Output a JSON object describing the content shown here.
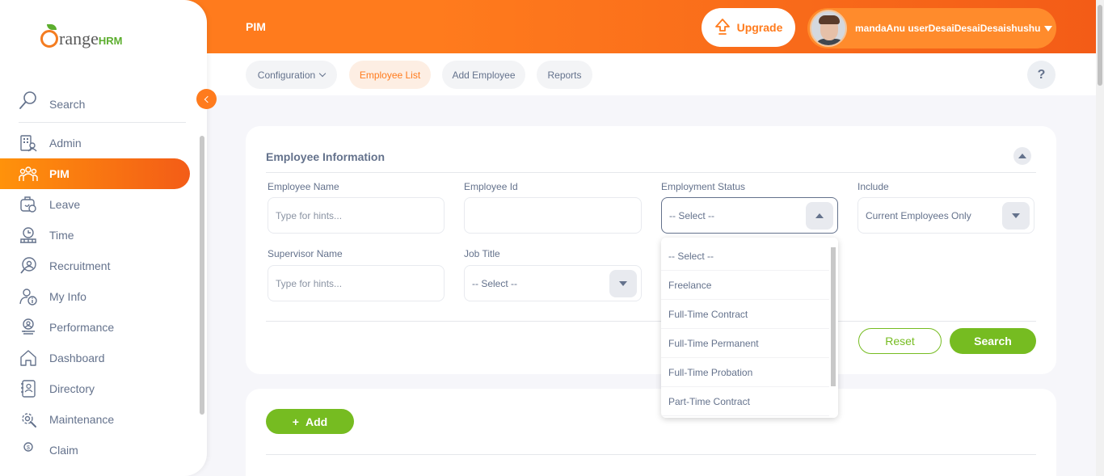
{
  "brand": {
    "logo_main": "range",
    "logo_hrm": "HRM"
  },
  "header": {
    "title": "PIM",
    "upgrade_label": "Upgrade",
    "user_name": "mandaAnu userDesaiDesaiDesaishushu",
    "colors": {
      "primary": "#ff7b1d",
      "secondary": "#f35c17",
      "success": "#76bc21"
    }
  },
  "subnav": {
    "tabs": [
      {
        "label": "Configuration",
        "has_dropdown": true
      },
      {
        "label": "Employee List",
        "active": true
      },
      {
        "label": "Add Employee"
      },
      {
        "label": "Reports"
      }
    ],
    "help_label": "?"
  },
  "sidebar": {
    "search_label": "Search",
    "items": [
      {
        "label": "Admin",
        "icon": "admin-icon"
      },
      {
        "label": "PIM",
        "icon": "pim-icon",
        "active": true
      },
      {
        "label": "Leave",
        "icon": "leave-icon"
      },
      {
        "label": "Time",
        "icon": "time-icon"
      },
      {
        "label": "Recruitment",
        "icon": "recruitment-icon"
      },
      {
        "label": "My Info",
        "icon": "my-info-icon"
      },
      {
        "label": "Performance",
        "icon": "performance-icon"
      },
      {
        "label": "Dashboard",
        "icon": "dashboard-icon"
      },
      {
        "label": "Directory",
        "icon": "directory-icon"
      },
      {
        "label": "Maintenance",
        "icon": "maintenance-icon"
      },
      {
        "label": "Claim",
        "icon": "claim-icon"
      }
    ]
  },
  "filter": {
    "title": "Employee Information",
    "employee_name": {
      "label": "Employee Name",
      "placeholder": "Type for hints..."
    },
    "employee_id": {
      "label": "Employee Id",
      "value": ""
    },
    "employment_status": {
      "label": "Employment Status",
      "value": "-- Select --"
    },
    "include": {
      "label": "Include",
      "value": "Current Employees Only"
    },
    "supervisor_name": {
      "label": "Supervisor Name",
      "placeholder": "Type for hints..."
    },
    "job_title": {
      "label": "Job Title",
      "value": "-- Select --"
    },
    "reset_label": "Reset",
    "search_label": "Search"
  },
  "status_dropdown": {
    "options": [
      "-- Select --",
      "Freelance",
      "Full-Time Contract",
      "Full-Time Permanent",
      "Full-Time Probation",
      "Part-Time Contract"
    ]
  },
  "list": {
    "add_label": "Add",
    "add_prefix": "+"
  }
}
